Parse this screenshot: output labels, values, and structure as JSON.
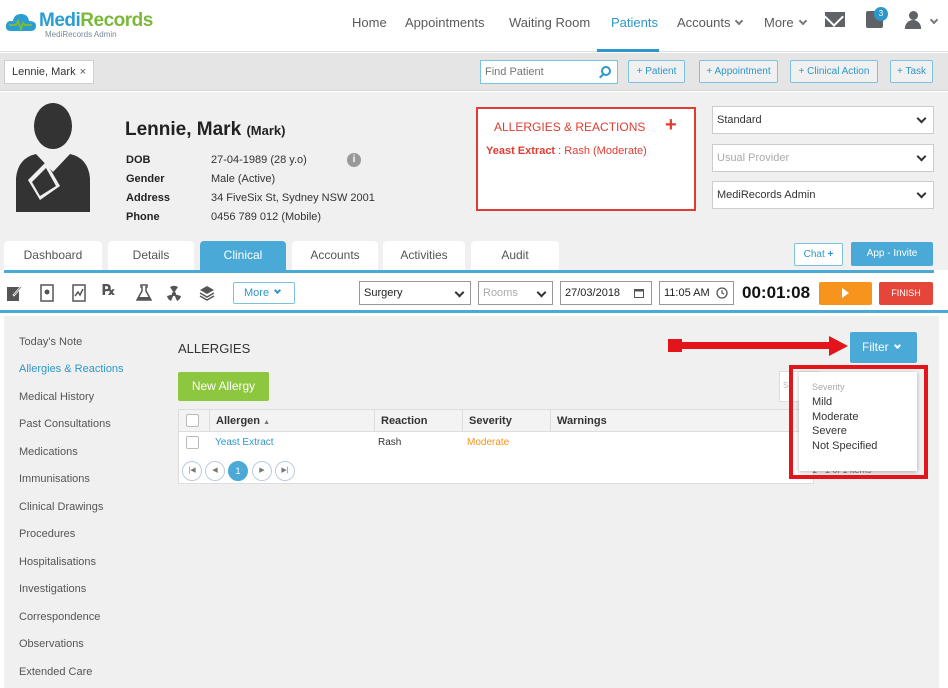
{
  "brand": {
    "name_a": "Medi",
    "name_b": "Records",
    "subtitle": "MediRecords Admin"
  },
  "nav": {
    "items": [
      "Home",
      "Appointments",
      "Waiting Room",
      "Patients",
      "Accounts",
      "More"
    ],
    "active": "Patients",
    "task_badge": "3"
  },
  "patient_tab": {
    "name": "Lennie, Mark",
    "close": "×"
  },
  "find_patient": {
    "placeholder": "Find Patient"
  },
  "quick_actions": [
    "+ Patient",
    "+ Appointment",
    "+ Clinical Action",
    "+ Task"
  ],
  "patient": {
    "name": "Lennie, Mark",
    "preferred": "(Mark)",
    "labels": {
      "dob": "DOB",
      "gender": "Gender",
      "address": "Address",
      "phone": "Phone"
    },
    "dob": "27-04-1989 (28 y.o)",
    "gender": "Male (Active)",
    "address": "34 FiveSix St, Sydney NSW 2001",
    "phone": "0456 789 012 (Mobile)"
  },
  "allergy_panel": {
    "title": "ALLERGIES & REACTIONS",
    "add": "+",
    "item_name": "Yeast Extract",
    "item_detail": " : Rash (Moderate)"
  },
  "selectors": {
    "billing": "Standard",
    "provider_placeholder": "Usual Provider",
    "practice": "MediRecords Admin"
  },
  "tabs": [
    "Dashboard",
    "Details",
    "Clinical",
    "Accounts",
    "Activities",
    "Audit"
  ],
  "active_tab": "Clinical",
  "chat": {
    "label": "Chat",
    "plus": "+"
  },
  "invite_label": "App - Invite",
  "toolbar": {
    "more": "More",
    "consult_type": "Surgery",
    "rooms_placeholder": "Rooms",
    "date": "27/03/2018",
    "time": "11:05 AM",
    "timer": "00:01:08",
    "finish": "FINISH"
  },
  "sidebar": [
    "Today's Note",
    "Allergies & Reactions",
    "Medical History",
    "Past Consultations",
    "Medications",
    "Immunisations",
    "Clinical Drawings",
    "Procedures",
    "Hospitalisations",
    "Investigations",
    "Correspondence",
    "Observations",
    "Extended Care"
  ],
  "sidebar_active": "Allergies & Reactions",
  "section": {
    "title": "ALLERGIES",
    "new_button": "New Allergy",
    "filter": "Filter",
    "search_placeholder": "Se"
  },
  "grid": {
    "columns": [
      "Allergen",
      "Reaction",
      "Severity",
      "Warnings"
    ],
    "sort_glyph": "▲",
    "rows": [
      {
        "allergen": "Yeast Extract",
        "reaction": "Rash",
        "severity": "Moderate",
        "warnings": ""
      }
    ],
    "page": "1",
    "items_text": "1 - 1 of 1 items"
  },
  "filter_menu": {
    "header": "Severity",
    "options": [
      "Mild",
      "Moderate",
      "Severe",
      "Not Specified"
    ]
  },
  "colors": {
    "accent": "#4aa9d6",
    "danger": "#e03c31",
    "severity_moderate": "#f7941d",
    "new_button": "#8dc63f"
  }
}
